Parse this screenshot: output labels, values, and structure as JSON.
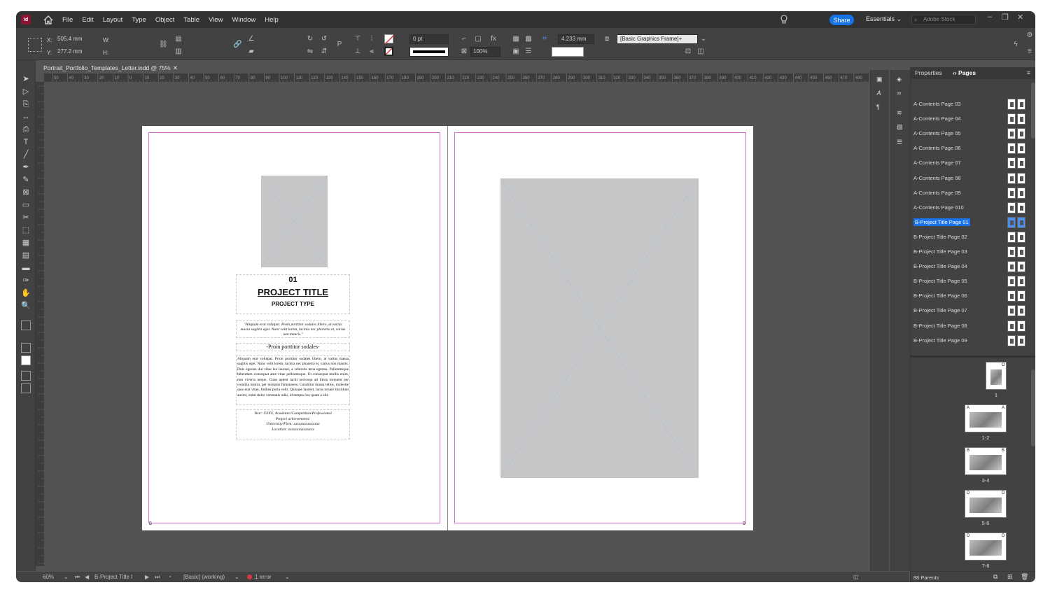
{
  "app": {
    "logo": "Id",
    "menu": [
      "File",
      "Edit",
      "Layout",
      "Type",
      "Object",
      "Table",
      "View",
      "Window",
      "Help"
    ],
    "share_label": "Share",
    "workspace_label": "Essentials",
    "stock_placeholder": "Adobe Stock"
  },
  "control_panel": {
    "x_label": "X:",
    "x_value": "505.4 mm",
    "y_label": "Y:",
    "y_value": "277.2 mm",
    "w_label": "W:",
    "h_label": "H:",
    "stroke_weight": "0 pt",
    "opacity": "100%",
    "offset": "4.233 mm",
    "object_style": "[Basic Graphics Frame]+"
  },
  "document": {
    "tab_title": "Portrait_Portfolio_Templates_Letter.indd @ 75%",
    "ruler_ticks": [
      "50",
      "40",
      "30",
      "20",
      "10",
      "0",
      "10",
      "20",
      "30",
      "40",
      "50",
      "60",
      "70",
      "80",
      "90",
      "100",
      "110",
      "120",
      "130",
      "140",
      "150",
      "160",
      "170",
      "180",
      "190",
      "200",
      "210",
      "220",
      "230",
      "240",
      "250",
      "260",
      "270",
      "280",
      "290",
      "300",
      "310",
      "320",
      "330",
      "340",
      "350",
      "360",
      "370",
      "380",
      "390",
      "400",
      "410",
      "420",
      "430",
      "440",
      "450",
      "460",
      "470",
      "480"
    ],
    "left_page": {
      "number": "01",
      "title": "PROJECT TITLE",
      "type": "PROJECT TYPE",
      "quote": "\"Aliquam erat volutpat. Proin porttitor sodales libero, at varius massa sagittis eget. Nunc velit lorem, lacinia nec pharetra et, varius non mauris.\"",
      "subheading": "-Proin porttitor sodales-",
      "body": "Aliquam erat volutpat. Proin porttitor sodales libero, at varius massa sagittis eget. Nunc velit lorem, lacinia nec pharetra et, varius non mauris. Duis egestas dui vitae leo laoreet, a vehicula urna egestas. Pellentesque bibendum consequat ante vitae pellentesque. Ut consequat mollis enim, non viverra neque. Class aptent taciti sociosqu ad litora torquent per conubia nostra, per inceptos himenaeos. Curabitur massa tellus, molestie quis erat vitae, finibus porta velit. Quisque laoreet, lacus ornare tincidunt auctor, enim dolor venenatis odio, id tempus leo quam a elit.",
      "meta": [
        "Year: XXXX, Academic/Competition/Professional",
        "Project achievements:",
        "University/Firm: xxxxxxxxxxxxxxx",
        "Location: xxxxxxxxxxxxxxx"
      ],
      "parent_marker": "B"
    },
    "right_page": {
      "parent_marker": "B"
    }
  },
  "statusbar": {
    "zoom": "60%",
    "page": "B-Project Title I",
    "preflight_profile": "[Basic] (working)",
    "errors": "1 error"
  },
  "pages_panel": {
    "tabs": [
      "Properties",
      "Pages"
    ],
    "parents": [
      {
        "label": "A-Contents Page 03",
        "selected": false
      },
      {
        "label": "A-Contents Page 04",
        "selected": false
      },
      {
        "label": "A-Contents Page 05",
        "selected": false
      },
      {
        "label": "A-Contents Page 06",
        "selected": false
      },
      {
        "label": "A-Contents Page 07",
        "selected": false
      },
      {
        "label": "A-Contents Page 08",
        "selected": false
      },
      {
        "label": "A-Contents Page 09",
        "selected": false
      },
      {
        "label": "A-Contents Page 010",
        "selected": false
      },
      {
        "label": "B-Project Title Page 01",
        "selected": true
      },
      {
        "label": "B-Project Title Page 02",
        "selected": false
      },
      {
        "label": "B-Project Title Page 03",
        "selected": false
      },
      {
        "label": "B-Project Title Page 04",
        "selected": false
      },
      {
        "label": "B-Project Title Page 05",
        "selected": false
      },
      {
        "label": "B-Project Title Page 06",
        "selected": false
      },
      {
        "label": "B-Project Title Page 07",
        "selected": false
      },
      {
        "label": "B-Project Title Page 08",
        "selected": false
      },
      {
        "label": "B-Project Title Page 09",
        "selected": false
      }
    ],
    "spreads": [
      {
        "label": "1",
        "markers": [
          "O"
        ]
      },
      {
        "label": "1-2",
        "markers": [
          "A",
          "A"
        ]
      },
      {
        "label": "3-4",
        "markers": [
          "B",
          "B"
        ]
      },
      {
        "label": "5-6",
        "markers": [
          "D",
          "D"
        ]
      },
      {
        "label": "7-8",
        "markers": [
          "D",
          "D"
        ]
      }
    ],
    "footer": "86 Parents"
  },
  "colors": {
    "accent": "#1473e6",
    "selection": "#1a73e8",
    "margin_guide": "#d46bd1",
    "image_placeholder": "#c5c6c8",
    "error_dot": "#d7373f"
  }
}
